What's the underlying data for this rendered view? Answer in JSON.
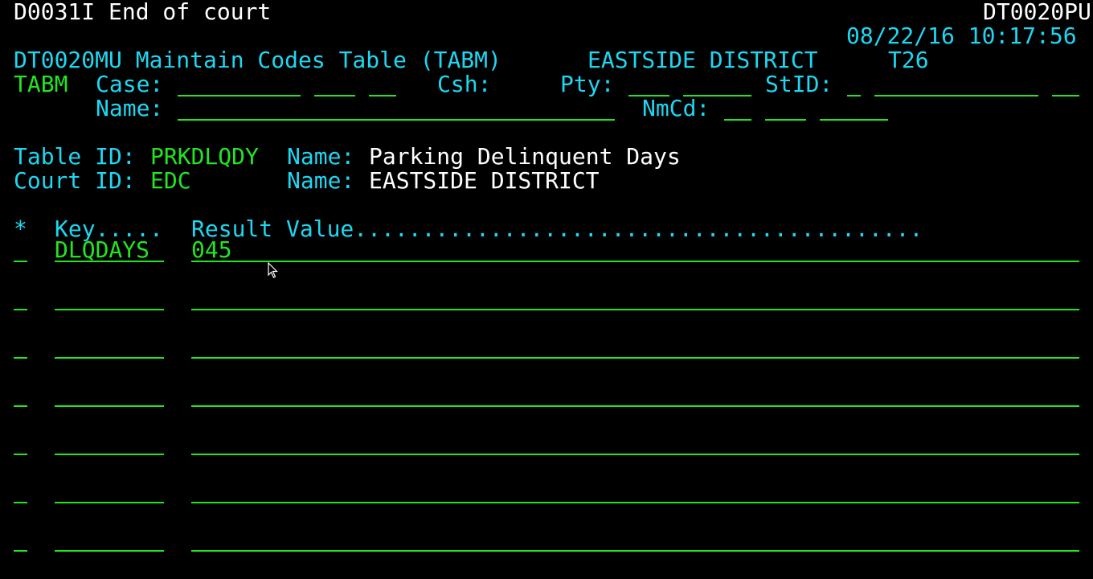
{
  "header": {
    "message": "D0031I End of court",
    "screen_code": "DT0020PU",
    "datetime": "08/22/16 10:17:56",
    "title": "DT0020MU Maintain Codes Table (TABM)",
    "district": "EASTSIDE DISTRICT",
    "terminal": "T26"
  },
  "search": {
    "tran": "TABM",
    "case_label": "Case:",
    "csh_label": "Csh:",
    "pty_label": "Pty:",
    "stid_label": "StID:",
    "name_label": "Name:",
    "nmcd_label": "NmCd:"
  },
  "info": {
    "table_id_label": "Table ID:",
    "table_id": "PRKDLQDY",
    "table_name_label": "Name:",
    "table_name": "Parking Delinquent Days",
    "court_id_label": "Court ID:",
    "court_id": "EDC",
    "court_name_label": "Name:",
    "court_name": "EASTSIDE DISTRICT"
  },
  "list": {
    "sel_header": "*",
    "key_header": "Key.....",
    "value_header": "Result Value..........................................",
    "rows": [
      {
        "sel": "",
        "key": "DLQDAYS",
        "value": "045"
      },
      {
        "sel": "",
        "key": "",
        "value": ""
      },
      {
        "sel": "",
        "key": "",
        "value": ""
      },
      {
        "sel": "",
        "key": "",
        "value": ""
      },
      {
        "sel": "",
        "key": "",
        "value": ""
      },
      {
        "sel": "",
        "key": "",
        "value": ""
      },
      {
        "sel": "",
        "key": "",
        "value": ""
      }
    ]
  },
  "colors": {
    "background": "#000000",
    "label_cyan": "#1ed7f2",
    "field_green": "#22e522",
    "text_white": "#ffffff"
  }
}
